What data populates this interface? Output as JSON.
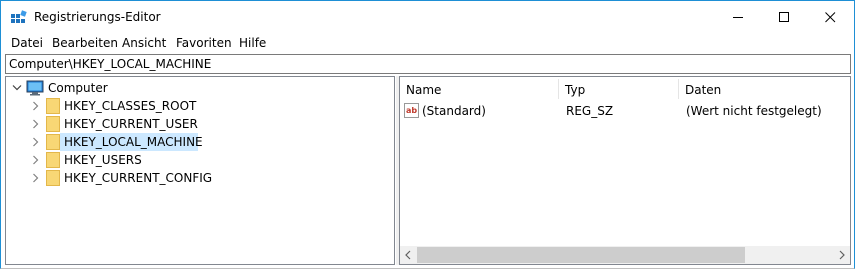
{
  "window": {
    "title": "Registrierungs-Editor"
  },
  "menu": [
    "Datei",
    "Bearbeiten",
    "Ansicht",
    "Favoriten",
    "Hilfe"
  ],
  "address": "Computer\\HKEY_LOCAL_MACHINE",
  "tree": {
    "root": "Computer",
    "hives": [
      "HKEY_CLASSES_ROOT",
      "HKEY_CURRENT_USER",
      "HKEY_LOCAL_MACHINE",
      "HKEY_USERS",
      "HKEY_CURRENT_CONFIG"
    ],
    "selected": "HKEY_LOCAL_MACHINE"
  },
  "columns": [
    "Name",
    "Typ",
    "Daten"
  ],
  "values": [
    {
      "name": "(Standard)",
      "type": "REG_SZ",
      "data": "(Wert nicht festgelegt)",
      "icon": "string-value-icon"
    }
  ],
  "colors": {
    "selection": "#cce8ff",
    "folder": "#f8d775",
    "accent": "#1e8fd5"
  }
}
